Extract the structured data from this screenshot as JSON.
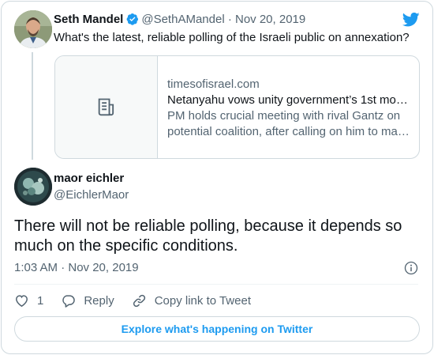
{
  "parent_tweet": {
    "name": "Seth Mandel",
    "handle": "@SethAMandel",
    "separator": "·",
    "date": "Nov 20, 2019",
    "text": "What's the latest, reliable polling of the Israeli public on annexation?",
    "verified": true,
    "link_card": {
      "domain": "timesofisrael.com",
      "title": "Netanyahu vows unity government’s 1st mo…",
      "description_line1": "PM holds crucial meeting with rival Gantz on",
      "description_line2": "potential coalition, after calling on him to ma…",
      "thumb_icon": "document-icon"
    }
  },
  "main_tweet": {
    "name": "maor eichler",
    "handle": "@EichlerMaor",
    "text": "There will not be reliable polling, because it depends so much on the specific conditions.",
    "timestamp": "1:03 AM · Nov 20, 2019",
    "actions": {
      "like_count": "1",
      "reply_label": "Reply",
      "copy_link_label": "Copy link to Tweet"
    }
  },
  "explore_label": "Explore what's happening on Twitter",
  "colors": {
    "accent": "#1d9bf0",
    "text": "#0f1419",
    "muted": "#536471",
    "border": "#cfd9de"
  },
  "icons": [
    "twitter-bird-icon",
    "verified-badge-icon",
    "document-icon",
    "info-icon",
    "heart-icon",
    "reply-icon",
    "link-icon"
  ]
}
